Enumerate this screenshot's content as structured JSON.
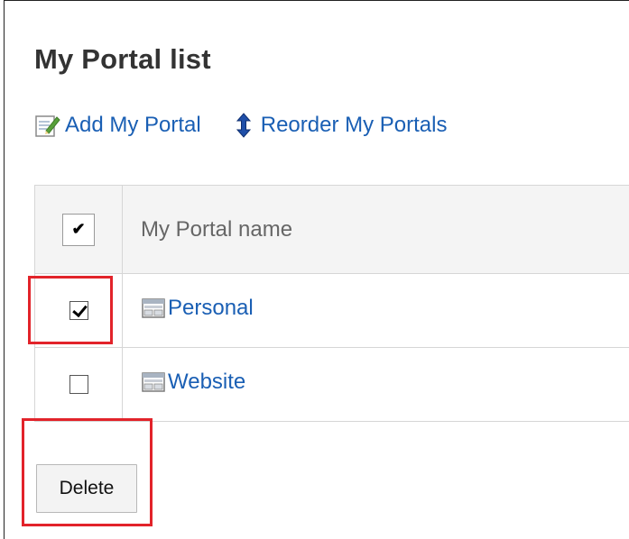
{
  "page": {
    "title": "My Portal list"
  },
  "actions": {
    "add": {
      "label": "Add My Portal",
      "icon": "edit-icon"
    },
    "reorder": {
      "label": "Reorder My Portals",
      "icon": "reorder-arrows-icon"
    }
  },
  "table": {
    "header": {
      "select_all_glyph": "✔",
      "name_label": "My Portal name"
    },
    "rows": [
      {
        "name": "Personal",
        "checked": true,
        "icon": "portal-icon"
      },
      {
        "name": "Website",
        "checked": false,
        "icon": "portal-icon"
      }
    ]
  },
  "delete_button": {
    "label": "Delete"
  },
  "colors": {
    "link": "#1a5fb4",
    "highlight": "#e2232a",
    "header_bg": "#f4f4f4"
  }
}
